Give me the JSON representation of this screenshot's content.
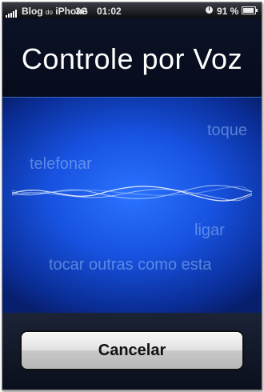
{
  "status_bar": {
    "signal_bars": 5,
    "carrier": "Blog",
    "carrier_small": "do",
    "carrier_suffix": "iPhone",
    "network": "3G",
    "time": "01:02",
    "battery": "91 %",
    "battery_level": 0.91,
    "icons": [
      "signal-icon",
      "alarm-icon",
      "battery-icon"
    ]
  },
  "title": "Controle por Voz",
  "voice_hints": [
    "toque",
    "telefonar",
    "ligar",
    "tocar outras como esta"
  ],
  "buttons": {
    "cancel": "Cancelar"
  },
  "colors": {
    "voice_blue": "#1752e0",
    "title_bg": "#070c1c",
    "hint_text": "#96b9f5"
  }
}
